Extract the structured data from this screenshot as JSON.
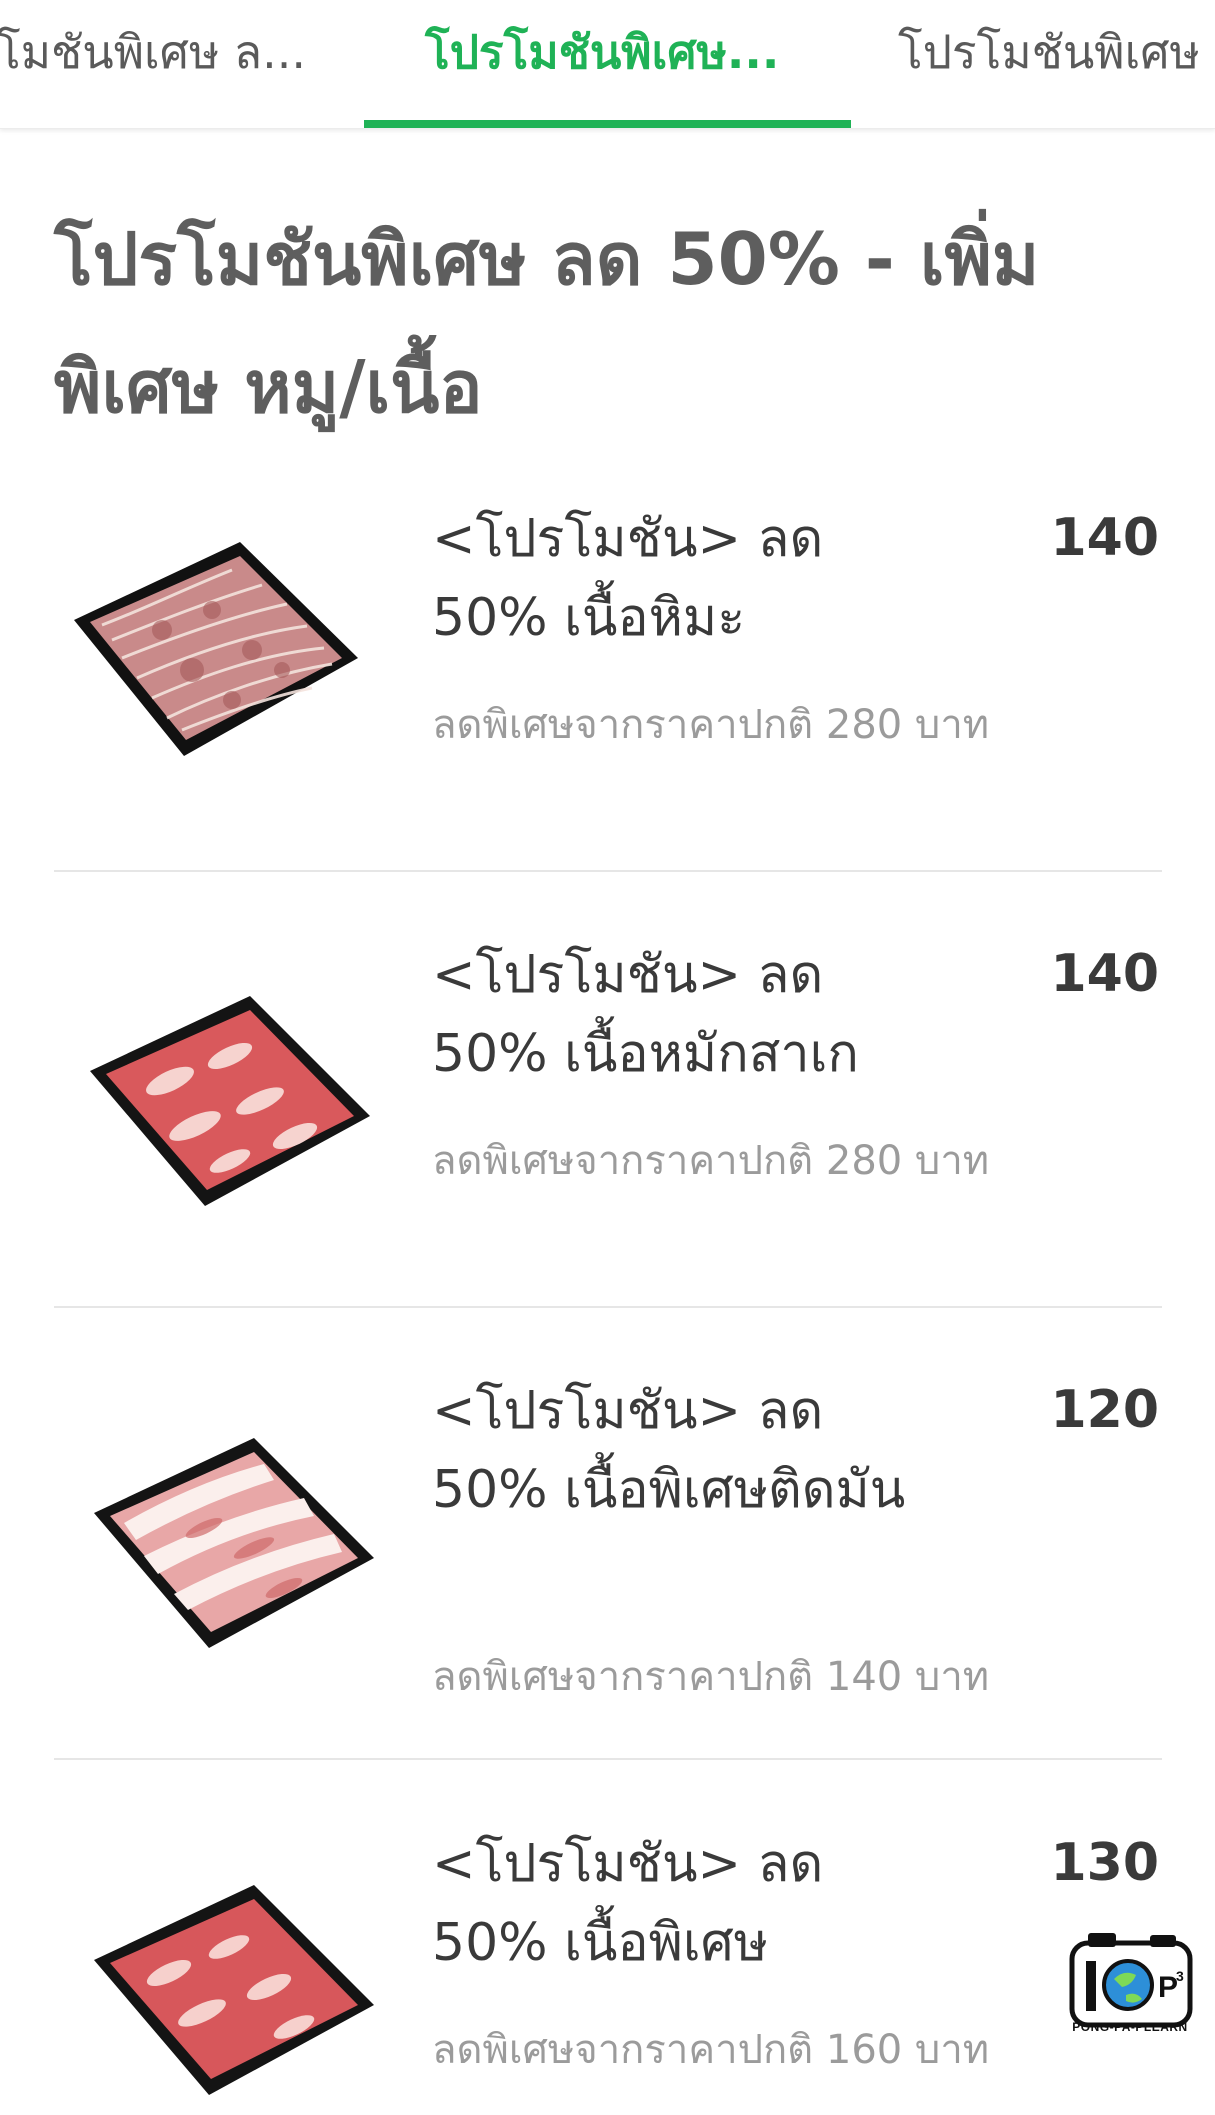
{
  "tabs": [
    {
      "label": "โมชันพิเศษ ล..."
    },
    {
      "label": "โปรโมชันพิเศษ..."
    },
    {
      "label": "โปรโมชันพิเศษ"
    }
  ],
  "active_tab_index": 1,
  "accent_color": "#1fb256",
  "section": {
    "title": "โปรโมชันพิเศษ ลด 50% - เพิ่มพิเศษ หมู/เนื้อ"
  },
  "items": [
    {
      "name": "<โปรโมชัน> ลด 50% เนื้อหิมะ",
      "price": "140",
      "desc": "ลดพิเศษจากราคาปกติ 280 บาท",
      "image": "marbled-beef-tray"
    },
    {
      "name": "<โปรโมชัน> ลด 50% เนื้อหมักสาเก",
      "price": "140",
      "desc": "ลดพิเศษจากราคาปกติ 280 บาท",
      "image": "sake-beef-tray"
    },
    {
      "name": "<โปรโมชัน> ลด 50% เนื้อพิเศษติดมัน",
      "price": "120",
      "desc": "ลดพิเศษจากราคาปกติ 140 บาท",
      "image": "fatty-beef-tray"
    },
    {
      "name": "<โปรโมชัน> ลด 50% เนื้อพิเศษ",
      "price": "130",
      "desc": "ลดพิเศษจากราคาปกติ 160 บาท",
      "image": "special-beef-tray"
    }
  ],
  "watermark": {
    "text": "PONG-PA-PLEARN",
    "icon": "camera-globe-logo"
  }
}
